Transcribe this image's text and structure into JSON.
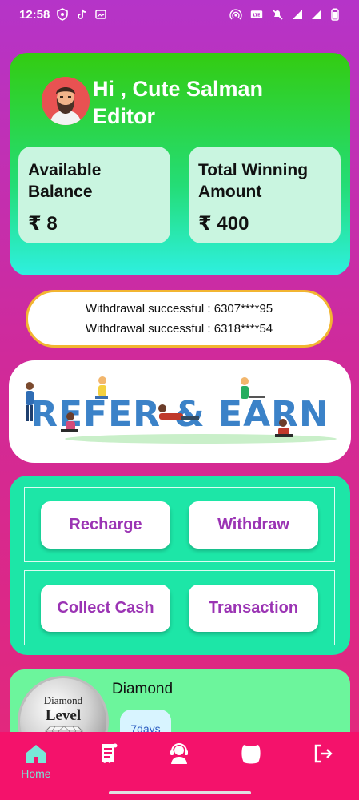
{
  "status_bar": {
    "time": "12:58",
    "left_icons": [
      "vpn-icon",
      "tiktok-icon",
      "gallery-icon"
    ],
    "right_icons": [
      "hotspot-icon",
      "volte-icon",
      "mute-icon",
      "signal-4g-icon",
      "signal-icon",
      "battery-icon"
    ],
    "volte_label": "VoLTE"
  },
  "header": {
    "greeting_line1": "Hi , Cute Salman",
    "greeting_line2": "Editor",
    "available_balance_label_1": "Available",
    "available_balance_label_2": "Balance",
    "available_balance_value": "₹ 8",
    "total_winning_label_1": "Total Winning",
    "total_winning_label_2": "Amount",
    "total_winning_value": "₹ 400",
    "colors": {
      "top": "#33cc11",
      "bottom": "#2ef0e0"
    }
  },
  "ticker": {
    "lines": [
      "Withdrawal successful : 6307****95",
      "Withdrawal successful : 6318****54"
    ]
  },
  "banner": {
    "text": "REFER & EARN",
    "text_color": "#3b82c8"
  },
  "actions": {
    "recharge": "Recharge",
    "withdraw": "Withdraw",
    "collect_cash": "Collect Cash",
    "transaction": "Transaction",
    "label_color": "#9b34b4"
  },
  "level": {
    "medal_line1": "Diamond",
    "medal_line2": "Level",
    "name": "Diamond",
    "days": "7days"
  },
  "bottom_nav": {
    "items": [
      {
        "icon": "home-icon",
        "label": "Home"
      },
      {
        "icon": "receipt-icon",
        "label": ""
      },
      {
        "icon": "support-agent-icon",
        "label": ""
      },
      {
        "icon": "wallet-icon",
        "label": ""
      },
      {
        "icon": "logout-icon",
        "label": ""
      }
    ],
    "active_color": "#78e8d8"
  }
}
